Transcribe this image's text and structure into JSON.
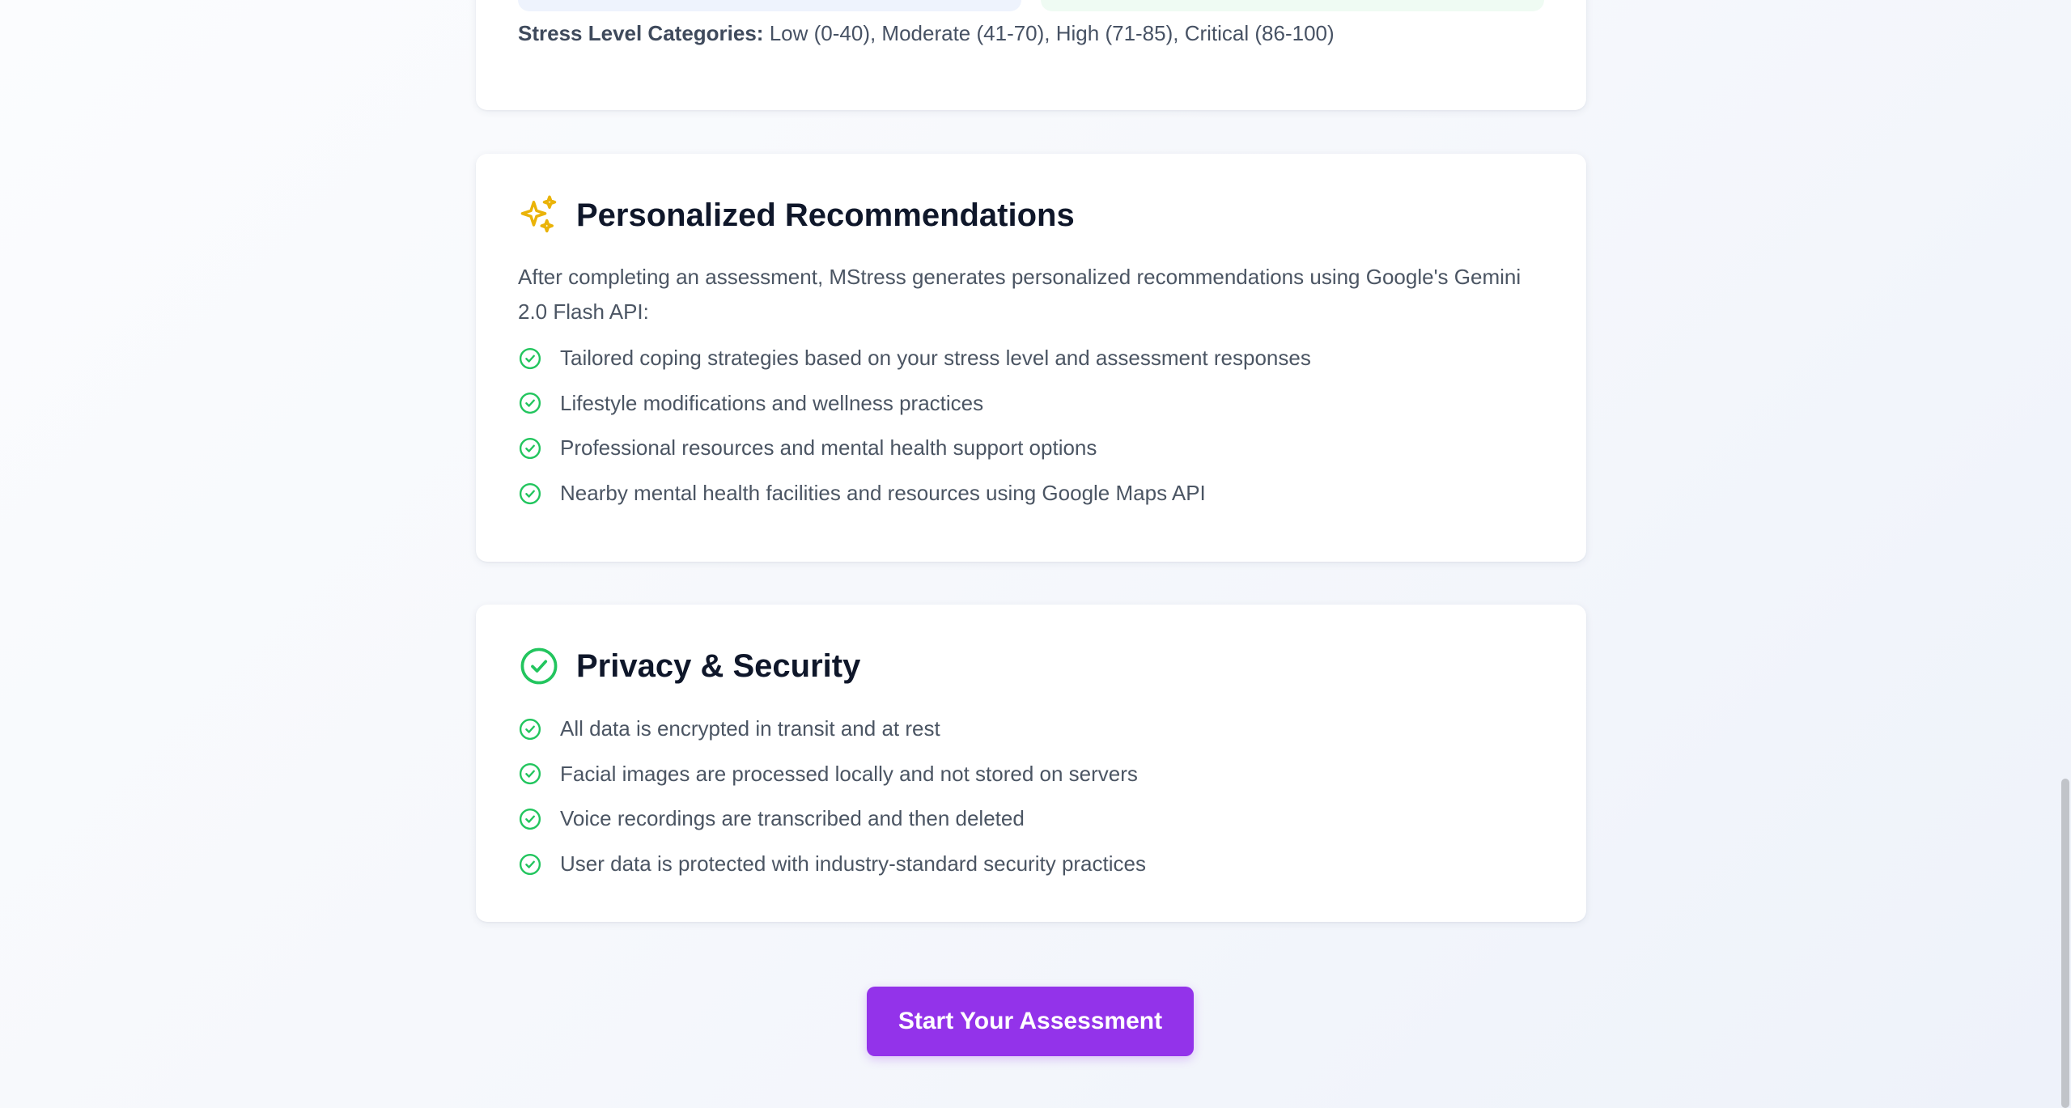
{
  "stress_levels": {
    "label": "Stress Level Categories:",
    "values": "Low (0-40), Moderate (41-70), High (71-85), Critical (86-100)"
  },
  "recommendations": {
    "icon": "sparkles-icon",
    "title": "Personalized Recommendations",
    "intro": "After completing an assessment, MStress generates personalized recommendations using Google's Gemini 2.0 Flash API:",
    "items": [
      "Tailored coping strategies based on your stress level and assessment responses",
      "Lifestyle modifications and wellness practices",
      "Professional resources and mental health support options",
      "Nearby mental health facilities and resources using Google Maps API"
    ]
  },
  "privacy": {
    "icon": "shield-check-icon",
    "title": "Privacy & Security",
    "items": [
      "All data is encrypted in transit and at rest",
      "Facial images are processed locally and not stored on servers",
      "Voice recordings are transcribed and then deleted",
      "User data is protected with industry-standard security practices"
    ]
  },
  "cta": {
    "label": "Start Your Assessment"
  },
  "colors": {
    "accent": "#9333ea",
    "check": "#22c55e",
    "sparkle": "#eab308"
  }
}
